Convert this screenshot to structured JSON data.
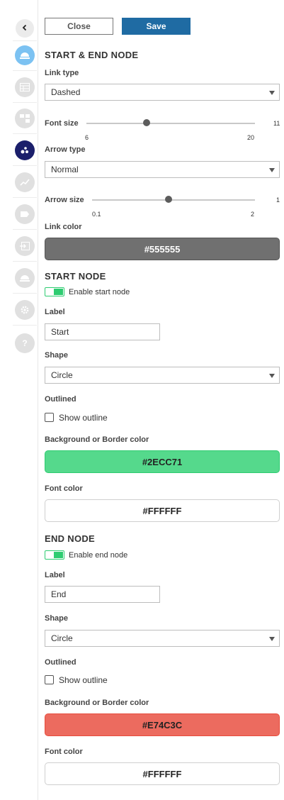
{
  "toolbar": {
    "close_label": "Close",
    "save_label": "Save"
  },
  "rail": {
    "icons": [
      "chevron-left-icon",
      "dome-icon",
      "table-icon",
      "hierarchy-icon",
      "nodes-icon",
      "trend-line-icon",
      "tag-icon",
      "import-icon",
      "dome-icon",
      "gear-icon",
      "help-icon"
    ],
    "active_color": "#1b1f6b",
    "first_color": "#7cc2f2",
    "inactive_color": "#e0e0e0"
  },
  "start_end": {
    "title": "START & END NODE",
    "link_type_label": "Link type",
    "link_type_value": "Dashed",
    "font_size_label": "Font size",
    "font_size_value": "11",
    "font_size_min": "6",
    "font_size_max": "20",
    "arrow_type_label": "Arrow type",
    "arrow_type_value": "Normal",
    "arrow_size_label": "Arrow size",
    "arrow_size_value": "1",
    "arrow_size_min": "0.1",
    "arrow_size_max": "2",
    "link_color_label": "Link color",
    "link_color_value": "#555555"
  },
  "start_node": {
    "title": "START NODE",
    "enable_label": "Enable start node",
    "label_label": "Label",
    "label_value": "Start",
    "shape_label": "Shape",
    "shape_value": "Circle",
    "outlined_label": "Outlined",
    "show_outline_label": "Show outline",
    "bg_label": "Background or Border color",
    "bg_value": "#2ECC71",
    "font_color_label": "Font color",
    "font_color_value": "#FFFFFF"
  },
  "end_node": {
    "title": "END NODE",
    "enable_label": "Enable end node",
    "label_label": "Label",
    "label_value": "End",
    "shape_label": "Shape",
    "shape_value": "Circle",
    "outlined_label": "Outlined",
    "show_outline_label": "Show outline",
    "bg_label": "Background or Border color",
    "bg_value": "#E74C3C",
    "font_color_label": "Font color",
    "font_color_value": "#FFFFFF"
  }
}
